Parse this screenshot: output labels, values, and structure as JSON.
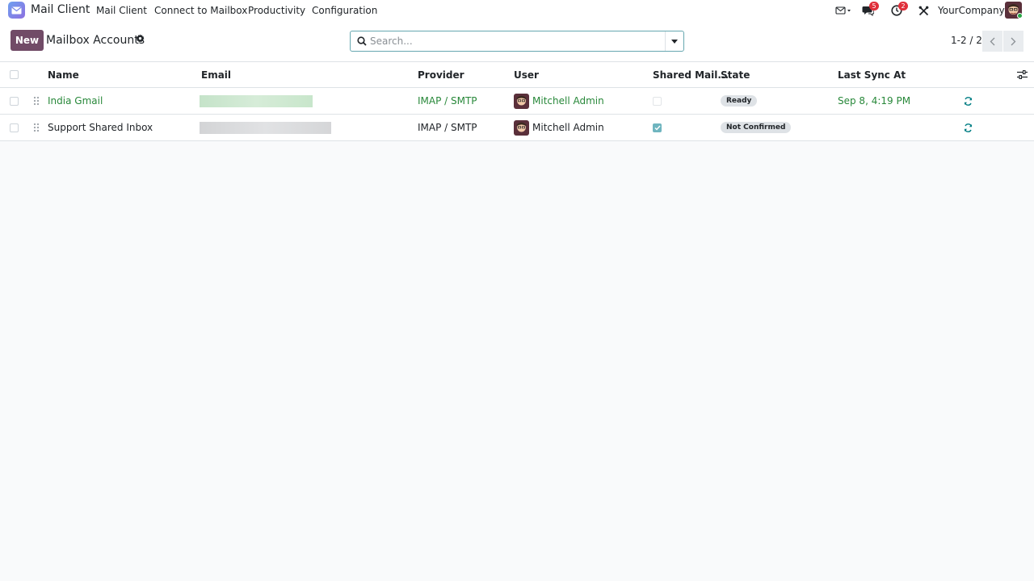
{
  "navbar": {
    "app_name": "Mail Client",
    "menu": [
      "Mail Client",
      "Connect to Mailbox",
      "Productivity",
      "Configuration"
    ],
    "messages_badge": "5",
    "activities_badge": "2",
    "company": "YourCompany"
  },
  "control_panel": {
    "new_label": "New",
    "title": "Mailbox Accounts",
    "search_placeholder": "Search...",
    "pager": "1-2 / 2"
  },
  "table": {
    "headers": {
      "name": "Name",
      "email": "Email",
      "provider": "Provider",
      "user": "User",
      "shared": "Shared Mail...",
      "state": "State",
      "last_sync": "Last Sync At"
    },
    "rows": [
      {
        "name": "India Gmail",
        "provider": "IMAP / SMTP",
        "user": "Mitchell Admin",
        "shared": false,
        "state": "Ready",
        "last_sync": "Sep 8, 4:19 PM"
      },
      {
        "name": "Support Shared Inbox",
        "provider": "IMAP / SMTP",
        "user": "Mitchell Admin",
        "shared": true,
        "state": "Not Confirmed",
        "last_sync": ""
      }
    ]
  },
  "colors": {
    "brand": "#714b67",
    "link_green": "#28883a",
    "accent_teal": "#017e84"
  }
}
